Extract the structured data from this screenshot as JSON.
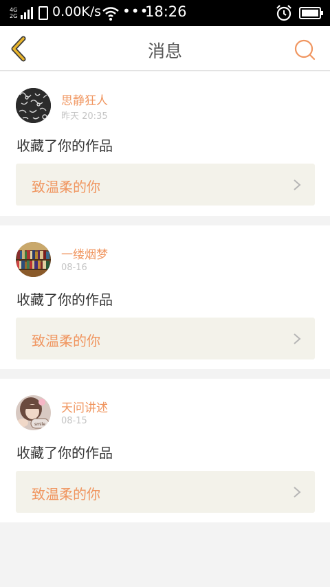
{
  "statusbar": {
    "net_top": "4G",
    "net_bottom": "2G",
    "speed": "0.00K/s",
    "dots": "•••",
    "time": "18:26"
  },
  "navbar": {
    "title": "消息",
    "accent_color": "#f0955f",
    "back_icon_color": "#e9b52c"
  },
  "messages": [
    {
      "user": "思静狂人",
      "time": "昨天 20:35",
      "action": "收藏了你的作品",
      "work_title": "致温柔的你",
      "avatar": "pattern-avatar"
    },
    {
      "user": "一缕烟梦",
      "time": "08-16",
      "action": "收藏了你的作品",
      "work_title": "致温柔的你",
      "avatar": "bookshelf-avatar"
    },
    {
      "user": "天问讲述",
      "time": "08-15",
      "action": "收藏了你的作品",
      "work_title": "致温柔的你",
      "avatar": "girl-avatar",
      "avatar_caption": "smile"
    }
  ]
}
